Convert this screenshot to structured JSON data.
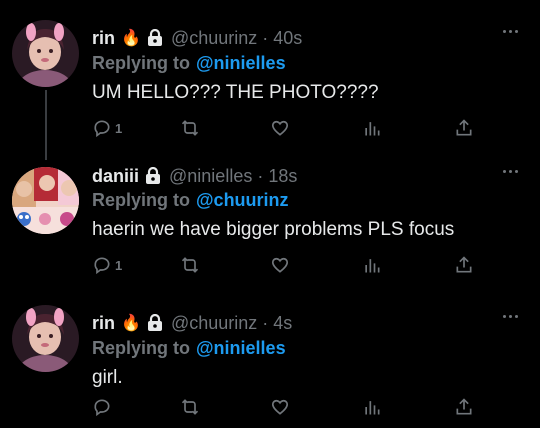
{
  "tweets": [
    {
      "name": "rin",
      "emoji": "🔥",
      "handle": "@chuurinz",
      "separator": "·",
      "time": "40s",
      "replying_label": "Replying to",
      "replying_to": "@ninielles",
      "text": "UM HELLO??? THE PHOTO????",
      "reply_count": "1",
      "avatar": "pink-bunny-girl-avatar"
    },
    {
      "name": "daniii",
      "handle": "@ninielles",
      "separator": "·",
      "time": "18s",
      "replying_label": "Replying to",
      "replying_to": "@chuurinz",
      "text": "haerin we have bigger problems PLS focus",
      "reply_count": "1",
      "avatar": "collage-avatar"
    },
    {
      "name": "rin",
      "emoji": "🔥",
      "handle": "@chuurinz",
      "separator": "·",
      "time": "4s",
      "replying_label": "Replying to",
      "replying_to": "@ninielles",
      "text": "girl.",
      "reply_count": "",
      "avatar": "pink-bunny-girl-avatar"
    }
  ],
  "colors": {
    "background": "#000000",
    "text": "#e7e9ea",
    "muted": "#71767b",
    "accent": "#1d9bf0",
    "thread_line": "#3a3d41"
  },
  "icons": [
    "reply-icon",
    "retweet-icon",
    "like-icon",
    "analytics-icon",
    "share-icon",
    "more-icon",
    "lock-icon"
  ]
}
